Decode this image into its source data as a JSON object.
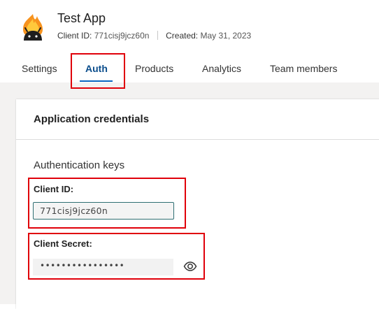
{
  "app": {
    "title": "Test App",
    "client_id_label": "Client ID:",
    "client_id_value": "771cisj9jcz60n",
    "created_label": "Created:",
    "created_value": "May 31, 2023",
    "logo_icon": "android-flame-icon"
  },
  "tabs": [
    {
      "label": "Settings"
    },
    {
      "label": "Auth"
    },
    {
      "label": "Products"
    },
    {
      "label": "Analytics"
    },
    {
      "label": "Team members"
    }
  ],
  "active_tab": "Auth",
  "card": {
    "title": "Application credentials",
    "section_title": "Authentication keys",
    "client_id_label": "Client ID:",
    "client_id_value": "771cisj9jcz60n",
    "client_secret_label": "Client Secret:",
    "client_secret_masked": "••••••••••••••••",
    "reveal_icon": "eye-icon"
  },
  "colors": {
    "accent": "#0a66c2",
    "highlight": "#e0000a",
    "page_bg": "#f3f2f1"
  }
}
